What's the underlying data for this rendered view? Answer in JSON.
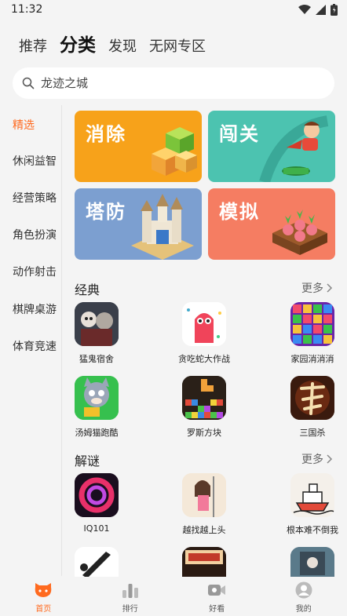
{
  "status_bar": {
    "time": "11:32"
  },
  "top_tabs": [
    {
      "label": "推荐",
      "active": false
    },
    {
      "label": "分类",
      "active": true
    },
    {
      "label": "发现",
      "active": false
    },
    {
      "label": "无网专区",
      "active": false
    }
  ],
  "search": {
    "placeholder": "龙迹之城"
  },
  "categories": [
    {
      "label": "精选",
      "active": true
    },
    {
      "label": "休闲益智"
    },
    {
      "label": "经营策略"
    },
    {
      "label": "角色扮演"
    },
    {
      "label": "动作射击"
    },
    {
      "label": "棋牌桌游"
    },
    {
      "label": "体育竞速"
    }
  ],
  "banners": [
    {
      "label": "消除",
      "color": "#f7a21a"
    },
    {
      "label": "闯关",
      "color": "#4cc3b0"
    },
    {
      "label": "塔防",
      "color": "#7c9fd0"
    },
    {
      "label": "模拟",
      "color": "#f57d62"
    }
  ],
  "sections": [
    {
      "title": "经典",
      "more": "更多",
      "apps": [
        {
          "name": "猛鬼宿舍",
          "icon": "ghost-dorm-icon"
        },
        {
          "name": "贪吃蛇大作战",
          "icon": "snake-icon"
        },
        {
          "name": "家园消消消",
          "icon": "match-blocks-icon"
        },
        {
          "name": "汤姆猫跑酷",
          "icon": "tom-cat-icon"
        },
        {
          "name": "罗斯方块",
          "icon": "tetris-icon"
        },
        {
          "name": "三国杀",
          "icon": "three-kingdoms-icon"
        }
      ]
    },
    {
      "title": "解谜",
      "more": "更多",
      "apps": [
        {
          "name": "IQ101",
          "icon": "iq-ring-icon"
        },
        {
          "name": "越找越上头",
          "icon": "girl-icon"
        },
        {
          "name": "根本难不倒我",
          "icon": "ship-sketch-icon"
        },
        {
          "name": "",
          "icon": "sword-icon"
        },
        {
          "name": "",
          "icon": "under-bed-icon"
        },
        {
          "name": "",
          "icon": "room-icon"
        }
      ]
    }
  ],
  "bottom_nav": [
    {
      "label": "首页",
      "icon": "home-cat-icon",
      "active": true
    },
    {
      "label": "排行",
      "icon": "rank-bars-icon"
    },
    {
      "label": "好看",
      "icon": "video-icon"
    },
    {
      "label": "我的",
      "icon": "profile-icon"
    }
  ],
  "colors": {
    "accent": "#ff6a1f",
    "background": "#f4f4f4"
  }
}
